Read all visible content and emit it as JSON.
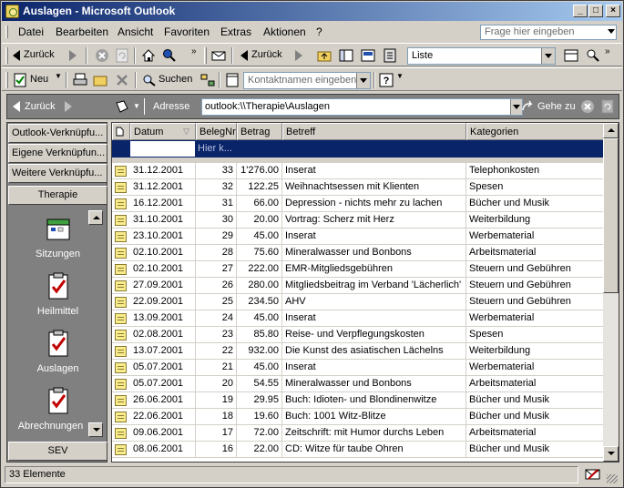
{
  "window": {
    "title": "Auslagen - Microsoft Outlook"
  },
  "menu": {
    "items": [
      "Datei",
      "Bearbeiten",
      "Ansicht",
      "Favoriten",
      "Extras",
      "Aktionen",
      "?"
    ],
    "ask_placeholder": "Frage hier eingeben"
  },
  "toolbar1": {
    "back_label": "Zurück",
    "back2_label": "Zurück",
    "list_view": "Liste"
  },
  "toolbar2": {
    "new_label": "Neu",
    "search_label": "Suchen",
    "contact_placeholder": "Kontaktnamen eingeben"
  },
  "addressbar": {
    "back_label": "Zurück",
    "address_label": "Adresse",
    "address_value": "outlook:\\\\Therapie\\Auslagen",
    "go_label": "Gehe zu"
  },
  "outlookbar": {
    "groups_top": [
      "Outlook-Verknüpfu...",
      "Eigene Verknüpfun...",
      "Weitere Verknüpfu...",
      "Therapie"
    ],
    "shortcuts": [
      "Sitzungen",
      "Heilmittel",
      "Auslagen",
      "Abrechnungen"
    ],
    "group_bottom": "SEV"
  },
  "table": {
    "columns": [
      "Datum",
      "BelegNr",
      "Betrag",
      "Betreff",
      "Kategorien"
    ],
    "new_row_hint": "Hier k...",
    "rows": [
      [
        "31.12.2001",
        "33",
        "1'276.00",
        "Inserat",
        "Telephonkosten"
      ],
      [
        "31.12.2001",
        "32",
        "122.25",
        "Weihnachtsessen mit Klienten",
        "Spesen"
      ],
      [
        "16.12.2001",
        "31",
        "66.00",
        "Depression - nichts mehr zu lachen",
        "Bücher und Musik"
      ],
      [
        "31.10.2001",
        "30",
        "20.00",
        "Vortrag: Scherz mit Herz",
        "Weiterbildung"
      ],
      [
        "23.10.2001",
        "29",
        "45.00",
        "Inserat",
        "Werbematerial"
      ],
      [
        "02.10.2001",
        "28",
        "75.60",
        "Mineralwasser und Bonbons",
        "Arbeitsmaterial"
      ],
      [
        "02.10.2001",
        "27",
        "222.00",
        "EMR-Mitgliedsgebühren",
        "Steuern und Gebühren"
      ],
      [
        "27.09.2001",
        "26",
        "280.00",
        "Mitgliedsbeitrag im Verband 'Lächerlich'",
        "Steuern und Gebühren"
      ],
      [
        "22.09.2001",
        "25",
        "234.50",
        "AHV",
        "Steuern und Gebühren"
      ],
      [
        "13.09.2001",
        "24",
        "45.00",
        "Inserat",
        "Werbematerial"
      ],
      [
        "02.08.2001",
        "23",
        "85.80",
        "Reise- und Verpflegungskosten",
        "Spesen"
      ],
      [
        "13.07.2001",
        "22",
        "932.00",
        "Die Kunst des asiatischen Lächelns",
        "Weiterbildung"
      ],
      [
        "05.07.2001",
        "21",
        "45.00",
        "Inserat",
        "Werbematerial"
      ],
      [
        "05.07.2001",
        "20",
        "54.55",
        "Mineralwasser und Bonbons",
        "Arbeitsmaterial"
      ],
      [
        "26.06.2001",
        "19",
        "29.95",
        "Buch: Idioten- und Blondinenwitze",
        "Bücher und Musik"
      ],
      [
        "22.06.2001",
        "18",
        "19.60",
        "Buch: 1001 Witz-Blitze",
        "Bücher und Musik"
      ],
      [
        "09.06.2001",
        "17",
        "72.00",
        "Zeitschrift: mit Humor durchs Leben",
        "Arbeitsmaterial"
      ],
      [
        "08.06.2001",
        "16",
        "22.00",
        "CD: Witze für taube Ohren",
        "Bücher und Musik"
      ]
    ]
  },
  "status": {
    "text": "33 Elemente"
  }
}
